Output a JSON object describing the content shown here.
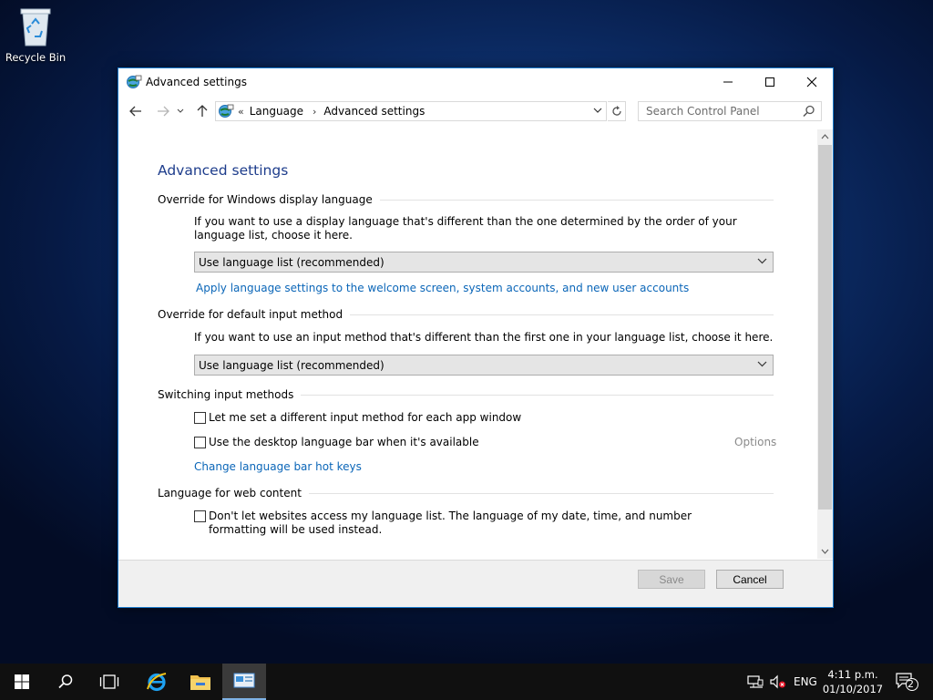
{
  "desktop": {
    "recycle_bin_label": "Recycle Bin"
  },
  "window": {
    "title": "Advanced settings",
    "icon": "control-panel-icon",
    "controls": [
      "minimize-icon",
      "maximize-icon",
      "close-icon"
    ]
  },
  "address": {
    "overflow": "«",
    "crumbs": [
      "Language",
      "Advanced settings"
    ],
    "search_placeholder": "Search Control Panel"
  },
  "content": {
    "page_title": "Advanced settings",
    "display_language": {
      "heading": "Override for Windows display language",
      "description": "If you want to use a display language that's different than the one determined by the order of your language list, choose it here.",
      "selected": "Use language list (recommended)",
      "link": "Apply language settings to the welcome screen, system accounts, and new user accounts"
    },
    "input_method": {
      "heading": "Override for default input method",
      "description": "If you want to use an input method that's different than the first one in your language list, choose it here.",
      "selected": "Use language list (recommended)"
    },
    "switching": {
      "heading": "Switching input methods",
      "check1": "Let me set a different input method for each app window",
      "check2": "Use the desktop language bar when it's available",
      "options": "Options",
      "link": "Change language bar hot keys"
    },
    "web_content": {
      "heading": "Language for web content",
      "check": "Don't let websites access my language list. The language of my date, time, and number formatting will be used instead."
    }
  },
  "footer": {
    "save": "Save",
    "cancel": "Cancel"
  },
  "taskbar": {
    "language": "ENG",
    "time": "4:11 p.m.",
    "date": "01/10/2017",
    "notification_count": "2"
  },
  "colors": {
    "accent": "#1979ca",
    "link": "#0b66b8",
    "title": "#1e3d8c"
  }
}
